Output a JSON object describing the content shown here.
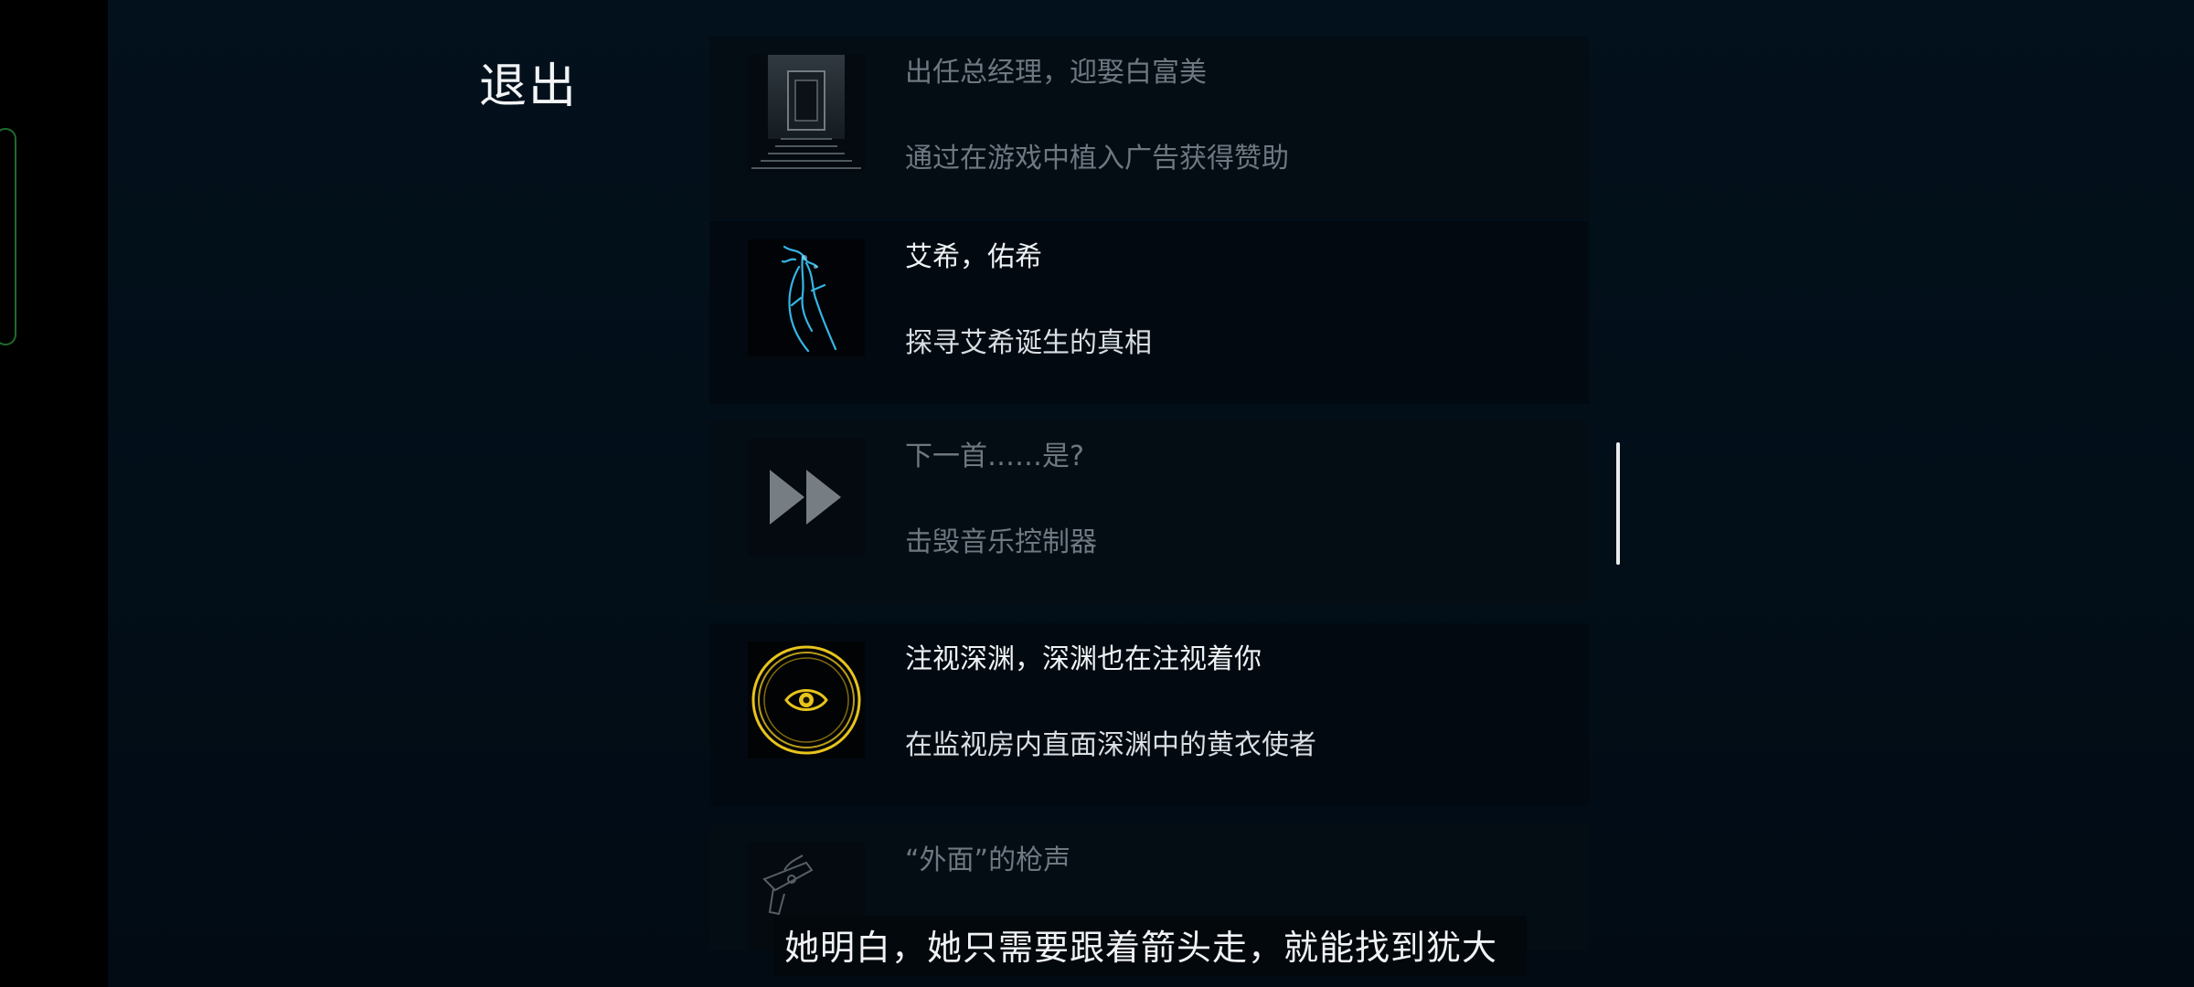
{
  "exit_label": "退出",
  "achievements": [
    {
      "title": "出任总经理，迎娶白富美",
      "desc": "通过在游戏中植入广告获得赞助",
      "state": "locked",
      "icon": "stairway-door-icon"
    },
    {
      "title": "艾希，佑希",
      "desc": "探寻艾希诞生的真相",
      "state": "unlocked",
      "icon": "blue-scythe-figure-icon"
    },
    {
      "title": "下一首……是?",
      "desc": "击毁音乐控制器",
      "state": "locked",
      "icon": "fast-forward-icon"
    },
    {
      "title": "注视深渊，深渊也在注视着你",
      "desc": "在监视房内直面深渊中的黄衣使者",
      "state": "unlocked",
      "icon": "yellow-eye-icon"
    },
    {
      "title": "“外面”的枪声",
      "desc": "",
      "state": "locked",
      "icon": "gun-icon"
    }
  ],
  "subtitle": "她明白，她只需要跟着箭头走，就能找到犹大",
  "colors": {
    "background": "#020e18",
    "card": "#020910",
    "accent_blue": "#35b6e6",
    "accent_yellow": "#e8c41c",
    "text": "#eef2f5",
    "text_locked": "#6e7880"
  }
}
